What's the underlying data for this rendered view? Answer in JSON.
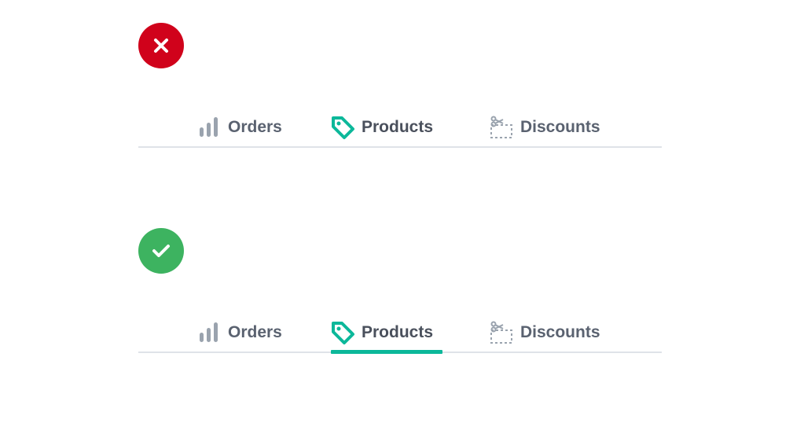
{
  "colors": {
    "error": "#d0021b",
    "success": "#3db360",
    "accent": "#0cb89a",
    "icon_gray": "#9aa3ae",
    "divider": "#dfe3e8"
  },
  "examples": [
    {
      "status": "incorrect",
      "status_icon": "close-icon",
      "tabs": [
        {
          "label": "Orders",
          "icon": "bar-chart-icon"
        },
        {
          "label": "Products",
          "icon": "tag-icon"
        },
        {
          "label": "Discounts",
          "icon": "scissors-coupon-icon"
        }
      ],
      "selected_tab": "Products",
      "show_underline": false
    },
    {
      "status": "correct",
      "status_icon": "check-icon",
      "tabs": [
        {
          "label": "Orders",
          "icon": "bar-chart-icon"
        },
        {
          "label": "Products",
          "icon": "tag-icon"
        },
        {
          "label": "Discounts",
          "icon": "scissors-coupon-icon"
        }
      ],
      "selected_tab": "Products",
      "show_underline": true
    }
  ]
}
